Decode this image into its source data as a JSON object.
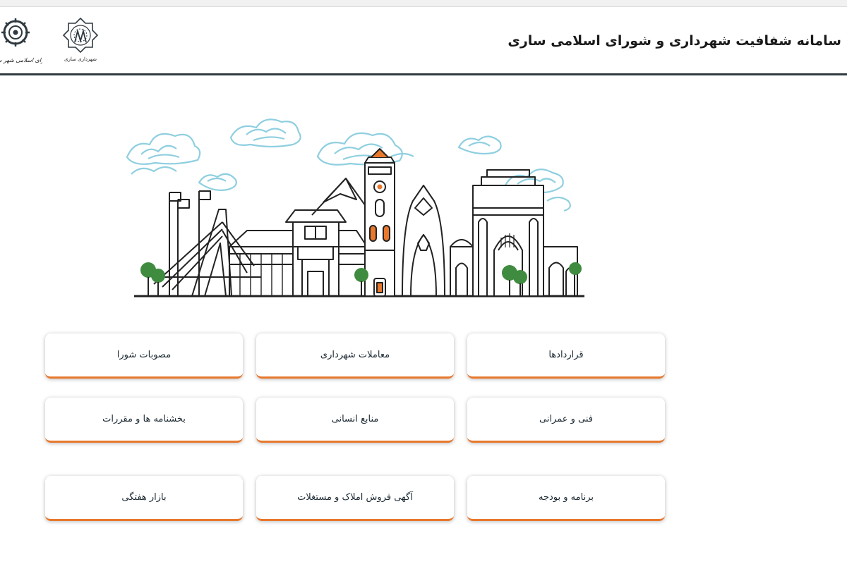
{
  "header": {
    "title": "سامانه شفافیت شهرداری و شورای اسلامی ساری",
    "logos": [
      {
        "icon": "municipality-logo-icon",
        "caption": "شهرداری ساری"
      },
      {
        "icon": "council-logo-icon",
        "caption": "شورای اسلامی شهر ساری"
      }
    ]
  },
  "illustration": {
    "icon": "city-skyline-illustration"
  },
  "tiles": [
    {
      "id": "contracts",
      "label": "قراردادها"
    },
    {
      "id": "municipal-transactions",
      "label": "معاملات شهرداری"
    },
    {
      "id": "council-resolutions",
      "label": "مصوبات شورا"
    },
    {
      "id": "technical-civil",
      "label": "فنی و عمرانی"
    },
    {
      "id": "human-resources",
      "label": "منابع انسانی"
    },
    {
      "id": "circulars-regulations",
      "label": "بخشنامه ها و مقررات"
    },
    {
      "id": "program-budget",
      "label": "برنامه و بودجه"
    },
    {
      "id": "property-sale-ads",
      "label": "آگهی فروش املاک و مستغلات"
    },
    {
      "id": "weekly-market",
      "label": "بازار هفتگی"
    }
  ],
  "colors": {
    "accent": "#e8782c",
    "header_line": "#2f3a40",
    "cloud": "#8fcfe0",
    "tree": "#3f8b3f"
  }
}
